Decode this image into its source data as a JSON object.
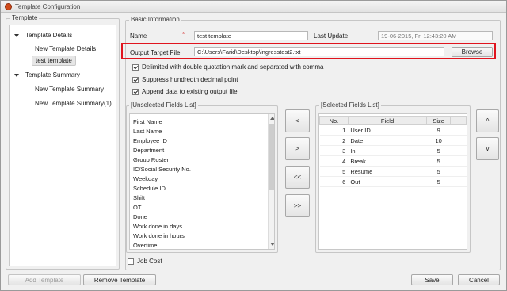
{
  "window": {
    "title": "Template Configuration"
  },
  "template_group": {
    "label": "Template",
    "tree": [
      {
        "label": "Template Details",
        "expanded": true
      },
      {
        "label": "New Template Details"
      },
      {
        "label": "test template",
        "selected": true
      },
      {
        "label": "Template Summary",
        "expanded": true
      },
      {
        "label": "New Template Summary"
      },
      {
        "label": "New Template Summary(1)"
      }
    ]
  },
  "basic_info": {
    "label": "Basic Information",
    "name_label": "Name",
    "required_mark": "*",
    "name_value": "test template",
    "last_update_label": "Last Update",
    "last_update_value": "19-06-2015, Fri  12:43:20 AM",
    "output_label": "Output Target File",
    "output_value": "C:\\Users\\Farid\\Desktop\\ingresstest2.txt",
    "browse_label": "Browse"
  },
  "options": [
    {
      "label": "Delimited with double quotation mark and separated with comma",
      "checked": true
    },
    {
      "label": "Suppress hundredth decimal point",
      "checked": true
    },
    {
      "label": "Append data to existing output file",
      "checked": true
    }
  ],
  "unselected": {
    "label": "[Unselected Fields List]",
    "items": [
      "First Name",
      "Last Name",
      "Employee ID",
      "Department",
      "Group Roster",
      "IC/Social Security No.",
      "Weekday",
      "Schedule ID",
      "Shift",
      "OT",
      "Done",
      "Work done in days",
      "Work done in hours",
      "Overtime"
    ]
  },
  "move_buttons": {
    "remove": "<",
    "add": ">",
    "remove_all": "<<",
    "add_all": ">>"
  },
  "selected": {
    "label": "[Selected Fields List]",
    "headers": {
      "no": "No.",
      "field": "Field",
      "size": "Size"
    },
    "rows": [
      {
        "no": "1",
        "field": "User ID",
        "size": "9"
      },
      {
        "no": "2",
        "field": "Date",
        "size": "10"
      },
      {
        "no": "3",
        "field": "In",
        "size": "5"
      },
      {
        "no": "4",
        "field": "Break",
        "size": "5"
      },
      {
        "no": "5",
        "field": "Resume",
        "size": "5"
      },
      {
        "no": "6",
        "field": "Out",
        "size": "5"
      }
    ]
  },
  "order_buttons": {
    "up": "^",
    "down": "v"
  },
  "job_cost": {
    "label": "Job Cost",
    "checked": false
  },
  "footer": {
    "add_template": "Add Template",
    "remove_template": "Remove Template",
    "save": "Save",
    "cancel": "Cancel"
  },
  "colors": {
    "highlight": "#e0141e",
    "app_icon": "#d04a1a"
  }
}
